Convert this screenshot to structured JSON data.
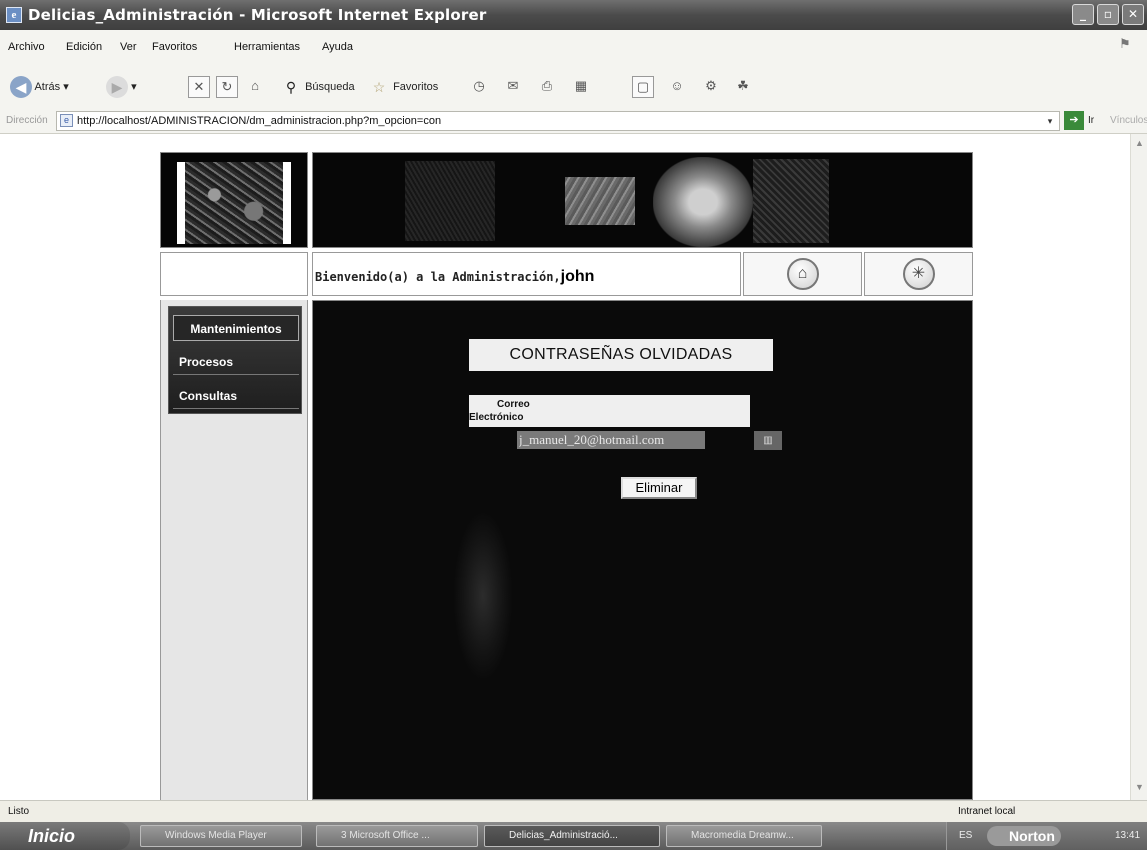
{
  "window": {
    "title": "Delicias_Administración - Microsoft Internet Explorer",
    "buttons": {
      "minimize": "_",
      "maximize": "▫",
      "close": "✕"
    }
  },
  "menubar": [
    "Archivo",
    "Edición",
    "Ver",
    "Favoritos",
    "Herramientas",
    "Ayuda"
  ],
  "toolbar": {
    "back": "Atrás",
    "search": "Búsqueda",
    "favorites": "Favoritos"
  },
  "address": {
    "label": "Dirección",
    "url": "http://localhost/ADMINISTRACION/dm_administracion.php?m_opcion=con",
    "go": "Ir",
    "links": "Vínculos"
  },
  "page": {
    "welcome_text": "Bienvenido(a) a la Administración,",
    "username": "john",
    "sidebar": {
      "items": [
        {
          "label": "Mantenimientos"
        },
        {
          "label": "Procesos"
        },
        {
          "label": "Consultas"
        }
      ]
    },
    "form": {
      "title": "CONTRASEÑAS OLVIDADAS",
      "email_label_line1": "Correo",
      "email_label_line2": "Electrónico",
      "email_value": "j_manuel_20@hotmail.com",
      "delete_button": "Eliminar"
    }
  },
  "statusbar": {
    "status": "Listo",
    "zone": "Intranet local"
  },
  "taskbar": {
    "start": "Inicio",
    "tasks": [
      {
        "label": "Windows Media Player"
      },
      {
        "label": "3 Microsoft Office ..."
      },
      {
        "label": "Delicias_Administració..."
      },
      {
        "label": "Macromedia Dreamw..."
      }
    ],
    "tray": {
      "lang": "ES",
      "norton": "Norton",
      "clock": "13:41"
    }
  }
}
